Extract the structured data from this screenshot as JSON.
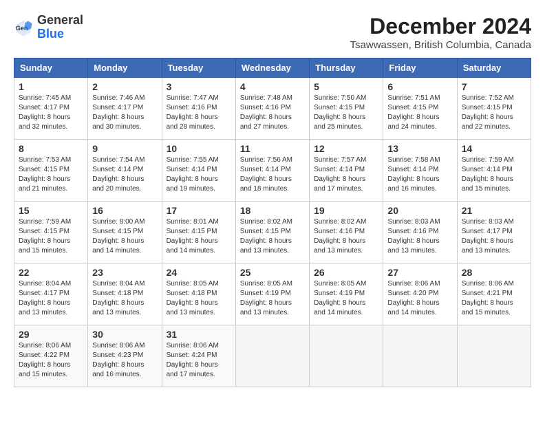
{
  "header": {
    "logo_general": "General",
    "logo_blue": "Blue",
    "month_title": "December 2024",
    "location": "Tsawwassen, British Columbia, Canada"
  },
  "days_of_week": [
    "Sunday",
    "Monday",
    "Tuesday",
    "Wednesday",
    "Thursday",
    "Friday",
    "Saturday"
  ],
  "weeks": [
    [
      {
        "day": 1,
        "sunrise": "7:45 AM",
        "sunset": "4:17 PM",
        "daylight": "8 hours and 32 minutes."
      },
      {
        "day": 2,
        "sunrise": "7:46 AM",
        "sunset": "4:17 PM",
        "daylight": "8 hours and 30 minutes."
      },
      {
        "day": 3,
        "sunrise": "7:47 AM",
        "sunset": "4:16 PM",
        "daylight": "8 hours and 28 minutes."
      },
      {
        "day": 4,
        "sunrise": "7:48 AM",
        "sunset": "4:16 PM",
        "daylight": "8 hours and 27 minutes."
      },
      {
        "day": 5,
        "sunrise": "7:50 AM",
        "sunset": "4:15 PM",
        "daylight": "8 hours and 25 minutes."
      },
      {
        "day": 6,
        "sunrise": "7:51 AM",
        "sunset": "4:15 PM",
        "daylight": "8 hours and 24 minutes."
      },
      {
        "day": 7,
        "sunrise": "7:52 AM",
        "sunset": "4:15 PM",
        "daylight": "8 hours and 22 minutes."
      }
    ],
    [
      {
        "day": 8,
        "sunrise": "7:53 AM",
        "sunset": "4:15 PM",
        "daylight": "8 hours and 21 minutes."
      },
      {
        "day": 9,
        "sunrise": "7:54 AM",
        "sunset": "4:14 PM",
        "daylight": "8 hours and 20 minutes."
      },
      {
        "day": 10,
        "sunrise": "7:55 AM",
        "sunset": "4:14 PM",
        "daylight": "8 hours and 19 minutes."
      },
      {
        "day": 11,
        "sunrise": "7:56 AM",
        "sunset": "4:14 PM",
        "daylight": "8 hours and 18 minutes."
      },
      {
        "day": 12,
        "sunrise": "7:57 AM",
        "sunset": "4:14 PM",
        "daylight": "8 hours and 17 minutes."
      },
      {
        "day": 13,
        "sunrise": "7:58 AM",
        "sunset": "4:14 PM",
        "daylight": "8 hours and 16 minutes."
      },
      {
        "day": 14,
        "sunrise": "7:59 AM",
        "sunset": "4:14 PM",
        "daylight": "8 hours and 15 minutes."
      }
    ],
    [
      {
        "day": 15,
        "sunrise": "7:59 AM",
        "sunset": "4:15 PM",
        "daylight": "8 hours and 15 minutes."
      },
      {
        "day": 16,
        "sunrise": "8:00 AM",
        "sunset": "4:15 PM",
        "daylight": "8 hours and 14 minutes."
      },
      {
        "day": 17,
        "sunrise": "8:01 AM",
        "sunset": "4:15 PM",
        "daylight": "8 hours and 14 minutes."
      },
      {
        "day": 18,
        "sunrise": "8:02 AM",
        "sunset": "4:15 PM",
        "daylight": "8 hours and 13 minutes."
      },
      {
        "day": 19,
        "sunrise": "8:02 AM",
        "sunset": "4:16 PM",
        "daylight": "8 hours and 13 minutes."
      },
      {
        "day": 20,
        "sunrise": "8:03 AM",
        "sunset": "4:16 PM",
        "daylight": "8 hours and 13 minutes."
      },
      {
        "day": 21,
        "sunrise": "8:03 AM",
        "sunset": "4:17 PM",
        "daylight": "8 hours and 13 minutes."
      }
    ],
    [
      {
        "day": 22,
        "sunrise": "8:04 AM",
        "sunset": "4:17 PM",
        "daylight": "8 hours and 13 minutes."
      },
      {
        "day": 23,
        "sunrise": "8:04 AM",
        "sunset": "4:18 PM",
        "daylight": "8 hours and 13 minutes."
      },
      {
        "day": 24,
        "sunrise": "8:05 AM",
        "sunset": "4:18 PM",
        "daylight": "8 hours and 13 minutes."
      },
      {
        "day": 25,
        "sunrise": "8:05 AM",
        "sunset": "4:19 PM",
        "daylight": "8 hours and 13 minutes."
      },
      {
        "day": 26,
        "sunrise": "8:05 AM",
        "sunset": "4:19 PM",
        "daylight": "8 hours and 14 minutes."
      },
      {
        "day": 27,
        "sunrise": "8:06 AM",
        "sunset": "4:20 PM",
        "daylight": "8 hours and 14 minutes."
      },
      {
        "day": 28,
        "sunrise": "8:06 AM",
        "sunset": "4:21 PM",
        "daylight": "8 hours and 15 minutes."
      }
    ],
    [
      {
        "day": 29,
        "sunrise": "8:06 AM",
        "sunset": "4:22 PM",
        "daylight": "8 hours and 15 minutes."
      },
      {
        "day": 30,
        "sunrise": "8:06 AM",
        "sunset": "4:23 PM",
        "daylight": "8 hours and 16 minutes."
      },
      {
        "day": 31,
        "sunrise": "8:06 AM",
        "sunset": "4:24 PM",
        "daylight": "8 hours and 17 minutes."
      },
      null,
      null,
      null,
      null
    ]
  ]
}
